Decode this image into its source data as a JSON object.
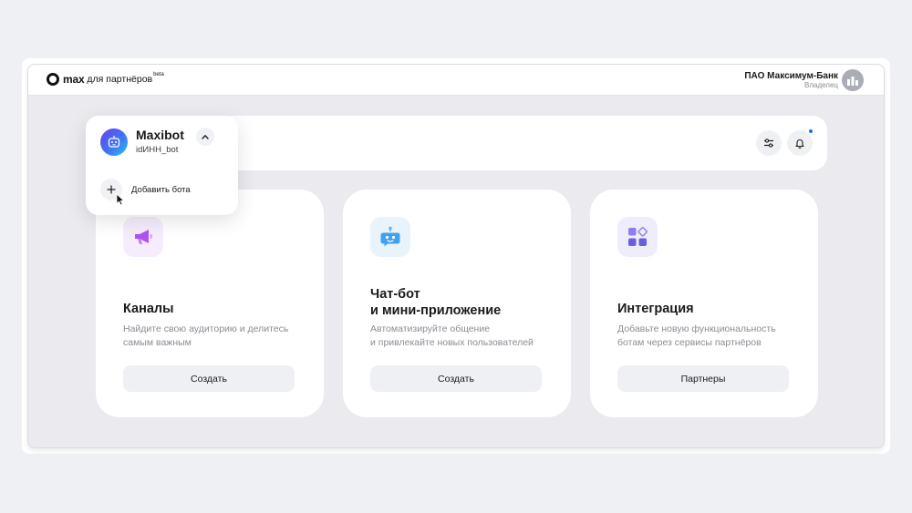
{
  "topbar": {
    "logo_word": "max",
    "logo_sub": "для партнёров",
    "logo_badge": "beta",
    "account_name": "ПАО Максимум-Банк",
    "account_role": "Владелец"
  },
  "bot_menu": {
    "bot_name": "Maxibot",
    "bot_handle": "idИНН_bot",
    "add_bot_label": "Добавить бота"
  },
  "cards": [
    {
      "title_line1": "Каналы",
      "title_line2": "",
      "desc_line1": "Найдите свою аудиторию и делитесь",
      "desc_line2": "самым важным",
      "button_label": "Создать",
      "icon": "megaphone-icon"
    },
    {
      "title_line1": "Чат-бот",
      "title_line2": "и мини-приложение",
      "desc_line1": "Автоматизируйте общение",
      "desc_line2": "и привлекайте новых пользователей",
      "button_label": "Создать",
      "icon": "robot-icon"
    },
    {
      "title_line1": "Интеграция",
      "title_line2": "",
      "desc_line1": "Добавьте новую функциональность",
      "desc_line2": "ботам через сервисы партнёров",
      "button_label": "Партнеры",
      "icon": "apps-grid-icon"
    }
  ],
  "colors": {
    "accent": "#1a73e8",
    "megaphone": "#b052f0",
    "robot": "#3fa2f0",
    "apps": "#6b5fe0"
  }
}
